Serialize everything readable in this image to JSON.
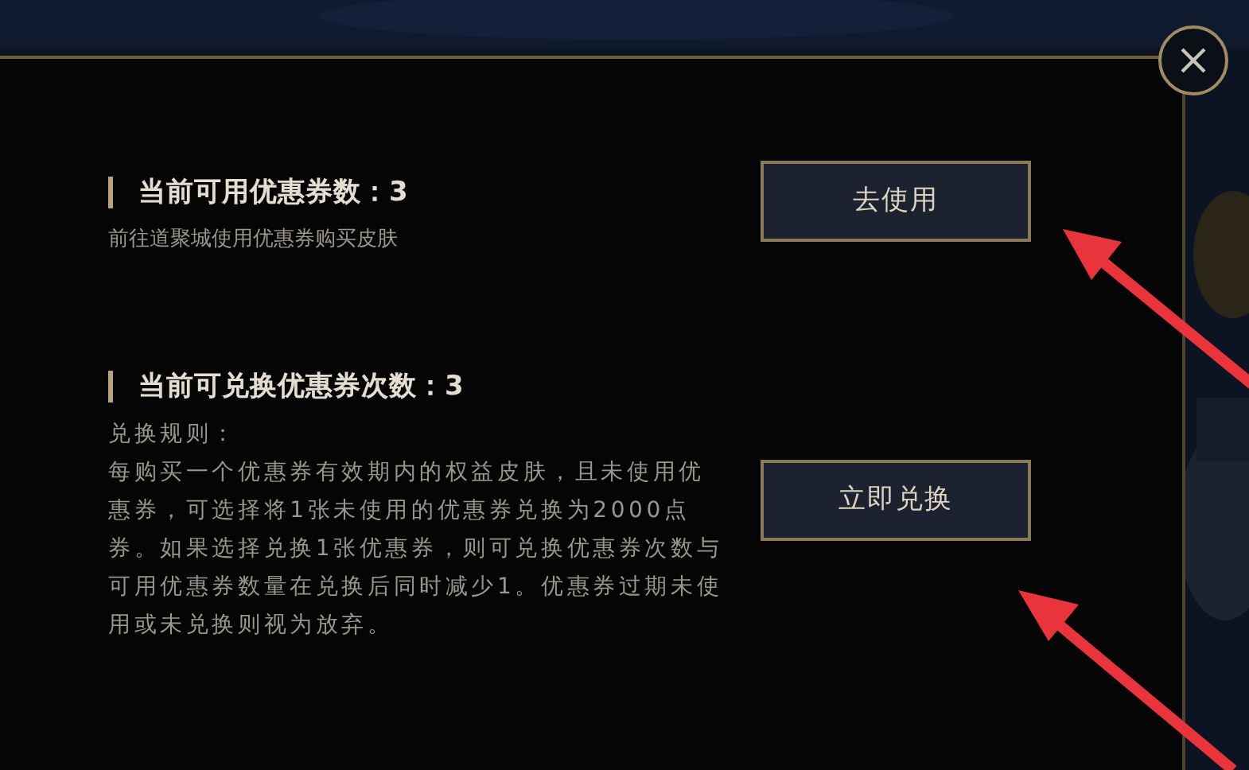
{
  "dialog": {
    "sections": [
      {
        "heading": "当前可用优惠券数：3",
        "lines": [
          "前往道聚城使用优惠券购买皮肤"
        ],
        "button": "去使用"
      },
      {
        "heading": "当前可兑换优惠券次数：3",
        "lines": [
          "兑换规则：",
          "每购买一个优惠券有效期内的权益皮肤，且未使用优惠券，可选择将1张未使用的优惠券兑换为2000点券。如果选择兑换1张优惠券，则可兑换优惠券次数与可用优惠券数量在兑换后同时减少1。优惠券过期未使用或未兑换则视为放弃。"
        ],
        "button": "立即兑换"
      }
    ]
  }
}
